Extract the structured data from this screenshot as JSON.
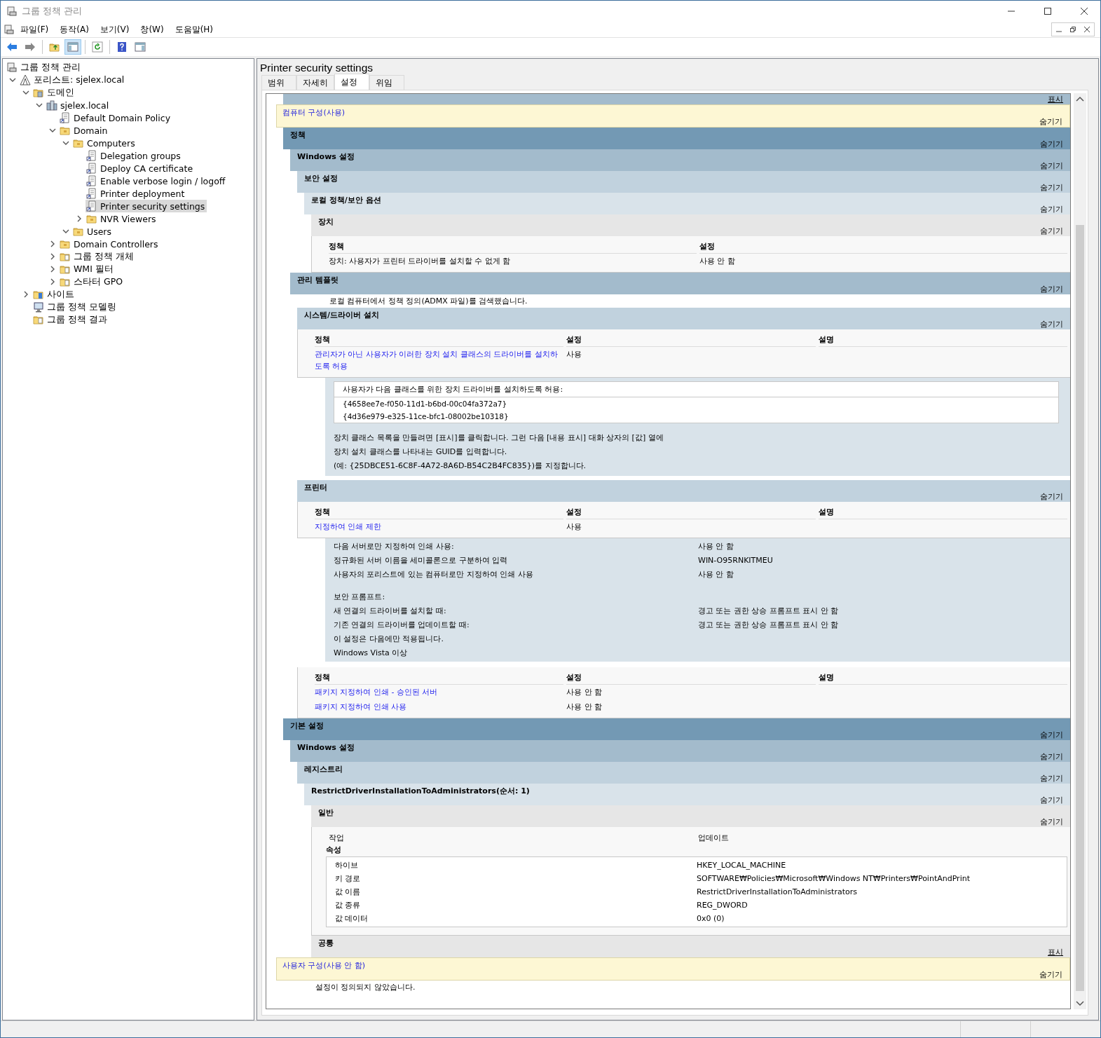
{
  "window": {
    "title": "그룹 정책 관리"
  },
  "menu": [
    "파일(F)",
    "동작(A)",
    "보기(V)",
    "창(W)",
    "도움말(H)"
  ],
  "toolbar": {
    "console_tree_on": true
  },
  "tree": {
    "root": {
      "label": "그룹 정책 관리",
      "selected": false
    },
    "items": [
      {
        "label": "포리스트: sjelex.local",
        "kind": "forest",
        "expanded": true,
        "selected": false,
        "children": [
          {
            "label": "도메인",
            "kind": "domains",
            "expanded": true,
            "selected": false,
            "children": [
              {
                "label": "sjelex.local",
                "kind": "domain",
                "expanded": true,
                "selected": false,
                "children": [
                  {
                    "label": "Default Domain Policy",
                    "kind": "gpo-link",
                    "selected": false
                  },
                  {
                    "label": "Domain",
                    "kind": "ou",
                    "expanded": true,
                    "selected": false,
                    "children": [
                      {
                        "label": "Computers",
                        "kind": "ou",
                        "expanded": true,
                        "selected": false,
                        "children": [
                          {
                            "label": "Delegation groups",
                            "kind": "gpo-link",
                            "selected": false
                          },
                          {
                            "label": "Deploy CA certificate",
                            "kind": "gpo-link",
                            "selected": false
                          },
                          {
                            "label": "Enable verbose login / logoff",
                            "kind": "gpo-link",
                            "selected": false
                          },
                          {
                            "label": "Printer deployment",
                            "kind": "gpo-link",
                            "selected": false
                          },
                          {
                            "label": "Printer security settings",
                            "kind": "gpo-link",
                            "selected": true
                          },
                          {
                            "label": "NVR Viewers",
                            "kind": "ou",
                            "expanded": false,
                            "selected": false
                          }
                        ]
                      },
                      {
                        "label": "Users",
                        "kind": "ou",
                        "expanded": true,
                        "selected": false
                      }
                    ]
                  },
                  {
                    "label": "Domain Controllers",
                    "kind": "ou",
                    "expanded": false,
                    "selected": false
                  },
                  {
                    "label": "그룹 정책 개체",
                    "kind": "gpo-folder",
                    "expanded": false,
                    "selected": false
                  },
                  {
                    "label": "WMI 필터",
                    "kind": "wmi-folder",
                    "expanded": false,
                    "selected": false
                  },
                  {
                    "label": "스타터 GPO",
                    "kind": "starter-folder",
                    "expanded": false,
                    "selected": false
                  }
                ]
              }
            ]
          },
          {
            "label": "사이트",
            "kind": "sites",
            "expanded": false,
            "selected": false
          },
          {
            "label": "그룹 정책 모델링",
            "kind": "modeling",
            "selected": false
          },
          {
            "label": "그룹 정책 결과",
            "kind": "results",
            "selected": false
          }
        ]
      }
    ]
  },
  "pane": {
    "title": "Printer security settings",
    "tabs": [
      {
        "label": "범위",
        "selected": false
      },
      {
        "label": "자세히",
        "selected": false
      },
      {
        "label": "설정",
        "selected": true
      },
      {
        "label": "위임",
        "selected": false
      }
    ]
  },
  "report": {
    "top_band": {
      "action": "표시"
    },
    "sections": [
      {
        "kind": "config",
        "title": "컴퓨터 구성(사용)",
        "action": "숨기기",
        "expanded": true,
        "children": [
          {
            "kind": "heading",
            "title": "정책",
            "action": "숨기기",
            "expanded": true,
            "children": [
              {
                "kind": "heading",
                "title": "Windows 설정",
                "action": "숨기기",
                "expanded": true,
                "children": [
                  {
                    "kind": "heading",
                    "title": "보안 설정",
                    "action": "숨기기",
                    "expanded": true,
                    "children": [
                      {
                        "kind": "heading",
                        "title": "로컬 정책/보안 옵션",
                        "action": "숨기기",
                        "expanded": true,
                        "children": [
                          {
                            "kind": "heading",
                            "title": "장치",
                            "action": "숨기기",
                            "expanded": true,
                            "children": [
                              {
                                "kind": "table",
                                "columns": [
                                  "정책",
                                  "설정"
                                ],
                                "rows": [
                                  {
                                    "link": false,
                                    "cells": [
                                      "장치: 사용자가 프린터 드라이버를 설치할 수 없게 함",
                                      "사용 안 함"
                                    ]
                                  }
                                ]
                              }
                            ]
                          }
                        ]
                      }
                    ]
                  }
                ]
              },
              {
                "kind": "heading",
                "title": "관리 템플릿",
                "action": "숨기기",
                "expanded": true,
                "children": [
                  {
                    "kind": "note",
                    "text": "로컬 컴퓨터에서 정책 정의(ADMX 파일)를 검색했습니다."
                  },
                  {
                    "kind": "heading",
                    "title": "시스템/드라이버 설치",
                    "action": "숨기기",
                    "expanded": true,
                    "children": [
                      {
                        "kind": "table",
                        "columns": [
                          "정책",
                          "설정",
                          "설명"
                        ],
                        "rows": [
                          {
                            "link": true,
                            "cells": [
                              "관리자가 아닌 사용자가 이러한 장치 설치 클래스의 드라이버를 설치하도록 허용",
                              "사용"
                            ]
                          }
                        ]
                      },
                      {
                        "kind": "detail",
                        "list_title": "사용자가 다음 클래스를 위한 장치 드라이버를 설치하도록 허용:",
                        "list_items": [
                          "{4658ee7e-f050-11d1-b6bd-00c04fa372a7}",
                          "{4d36e979-e325-11ce-bfc1-08002be10318}"
                        ],
                        "lines": [
                          "장치 클래스 목록을 만들려면 [표시]를 클릭합니다. 그런 다음 [내용 표시] 대화 상자의 [값] 열에",
                          "장치 설치 클래스를 나타내는 GUID를 입력합니다.",
                          "(예: {25DBCE51-6C8F-4A72-8A6D-B54C2B4FC835})를 지정합니다."
                        ]
                      }
                    ]
                  },
                  {
                    "kind": "heading",
                    "title": "프린터",
                    "action": "숨기기",
                    "expanded": true,
                    "children": [
                      {
                        "kind": "table",
                        "columns": [
                          "정책",
                          "설정",
                          "설명"
                        ],
                        "rows": [
                          {
                            "link": true,
                            "cells": [
                              "지정하여 인쇄 제한",
                              "사용"
                            ]
                          }
                        ]
                      },
                      {
                        "kind": "pairs",
                        "groups": [
                          [
                            {
                              "label": "다음 서버로만 지정하여 인쇄 사용:",
                              "value": "사용 안 함"
                            },
                            {
                              "label": "정규화된 서버 이름을 세미콜론으로 구분하여 입력",
                              "value": "WIN-O95RNKITMEU"
                            },
                            {
                              "label": "사용자의 포리스트에 있는 컴퓨터로만 지정하여 인쇄 사용",
                              "value": "사용 안 함"
                            }
                          ],
                          [
                            {
                              "label": "보안 프롬프트:"
                            },
                            {
                              "label": "새 연결의 드라이버를 설치할 때:",
                              "value": "경고 또는 권한 상승 프롬프트 표시 안 함"
                            },
                            {
                              "label": "기존 연결의 드라이버를 업데이트할 때:",
                              "value": "경고 또는 권한 상승 프롬프트 표시 안 함"
                            },
                            {
                              "label": "이 설정은 다음에만 적용됩니다."
                            },
                            {
                              "label": "Windows Vista 이상"
                            }
                          ]
                        ]
                      },
                      {
                        "kind": "table",
                        "columns": [
                          "정책",
                          "설정",
                          "설명"
                        ],
                        "rows": [
                          {
                            "link": true,
                            "cells": [
                              "패키지 지정하여 인쇄 - 승인된 서버",
                              "사용 안 함"
                            ]
                          },
                          {
                            "link": true,
                            "cells": [
                              "패키지 지정하여 인쇄 사용",
                              "사용 안 함"
                            ]
                          }
                        ]
                      }
                    ]
                  }
                ]
              }
            ]
          },
          {
            "kind": "heading",
            "title": "기본 설정",
            "action": "숨기기",
            "expanded": true,
            "children": [
              {
                "kind": "heading",
                "title": "Windows 설정",
                "action": "숨기기",
                "expanded": true,
                "children": [
                  {
                    "kind": "heading",
                    "title": "레지스트리",
                    "action": "숨기기",
                    "expanded": true,
                    "children": [
                      {
                        "kind": "heading",
                        "title": "RestrictDriverInstallationToAdministrators(순서: 1)",
                        "action": "숨기기",
                        "expanded": true,
                        "children": [
                          {
                            "kind": "heading",
                            "title": "일반",
                            "action": "숨기기",
                            "expanded": true,
                            "children": [
                              {
                                "kind": "properties",
                                "action_label": "작업",
                                "action_value": "업데이트",
                                "caption": "속성",
                                "rows": [
                                  {
                                    "label": "하이브",
                                    "value": "HKEY_LOCAL_MACHINE"
                                  },
                                  {
                                    "label": "키 경로",
                                    "value": "SOFTWARE₩Policies₩Microsoft₩Windows NT₩Printers₩PointAndPrint"
                                  },
                                  {
                                    "label": "값 이름",
                                    "value": "RestrictDriverInstallationToAdministrators"
                                  },
                                  {
                                    "label": "값 종류",
                                    "value": "REG_DWORD"
                                  },
                                  {
                                    "label": "값 데이터",
                                    "value": "0x0 (0)"
                                  }
                                ]
                              }
                            ]
                          },
                          {
                            "kind": "heading",
                            "title": "공통",
                            "action": "표시",
                            "expanded": false
                          }
                        ]
                      }
                    ]
                  }
                ]
              }
            ]
          }
        ]
      },
      {
        "kind": "config",
        "title": "사용자 구성(사용 안 함)",
        "action": "숨기기",
        "expanded": true,
        "children": [
          {
            "kind": "note",
            "text": "설정이 정의되지 않았습니다."
          }
        ]
      }
    ]
  }
}
